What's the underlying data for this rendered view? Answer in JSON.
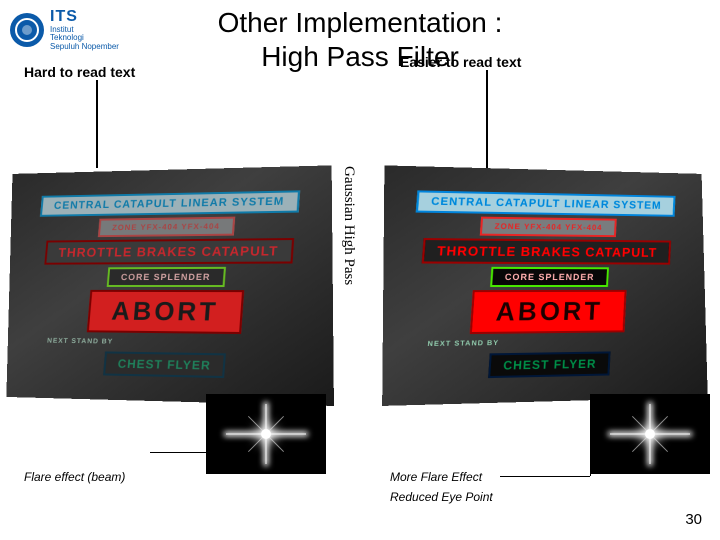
{
  "logo": {
    "its": "ITS",
    "subtitle": "Institut\nTeknologi\nSepuluh Nopember"
  },
  "title": {
    "line1": "Other Implementation :",
    "line2": "High Pass Filter"
  },
  "labels": {
    "hard": "Hard to read text",
    "easy": "Easier to read text",
    "vertical": "Gaussian High Pass",
    "flare_left": "Flare effect (beam)",
    "flare_right": "More Flare Effect",
    "reduced": "Reduced Eye Point"
  },
  "panel": {
    "teal": "CENTRAL CATAPULT LINEAR SYSTEM",
    "zone": "ZONE   YFX-404   YFX-404",
    "red": "THROTTLE BRAKES CATAPULT",
    "core": "CORE SPLENDER",
    "abort": "ABORT",
    "next": "NEXT STAND BY",
    "chest": "CHEST FLYER"
  },
  "page_number": "30"
}
